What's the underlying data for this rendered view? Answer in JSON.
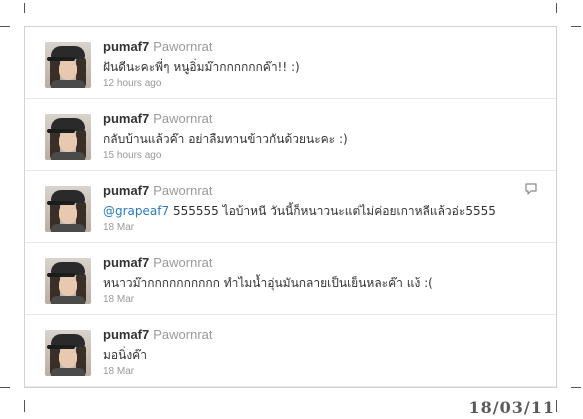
{
  "tweets": [
    {
      "handle": "pumaf7",
      "realname": "Pawornrat",
      "text": "ฝันดีนะคะพี่ๆ หนูอิ่มม๊ากกกกกกค๊า!! :)",
      "time": "12 hours ago",
      "avatar_icon": "profile-photo-cap-girl"
    },
    {
      "handle": "pumaf7",
      "realname": "Pawornrat",
      "text": "กลับบ้านแล้วค๊า อย่าลืมทานข้าวกันด้วยนะคะ :)",
      "time": "15 hours ago",
      "avatar_icon": "profile-photo-cap-girl"
    },
    {
      "handle": "pumaf7",
      "realname": "Pawornrat",
      "mention": "@grapeaf7",
      "text": " 555555 ไอบ้าหนี วันนี้ก็หนาวนะแต่ไม่ค่อยเกาหลีแล้วอ่ะ5555",
      "time": "18 Mar",
      "avatar_icon": "profile-photo-cap-girl",
      "reply_icon": "reply-speech-bubble"
    },
    {
      "handle": "pumaf7",
      "realname": "Pawornrat",
      "text": "หนาวม๊ากกกกกกกกกก ทำไมน้ำอุ่นมันกลายเป็นเย็นหละค๊า แง้ :(",
      "time": "18 Mar",
      "avatar_icon": "profile-photo-cap-girl"
    },
    {
      "handle": "pumaf7",
      "realname": "Pawornrat",
      "text": "มอนิ่งค๊า",
      "time": "18 Mar",
      "avatar_icon": "profile-photo-cap-girl"
    }
  ],
  "date_stamp": "18/03/11",
  "colors": {
    "link": "#2b7bb9",
    "handle": "#333333",
    "meta": "#999999",
    "divider": "#e6e6e6"
  }
}
